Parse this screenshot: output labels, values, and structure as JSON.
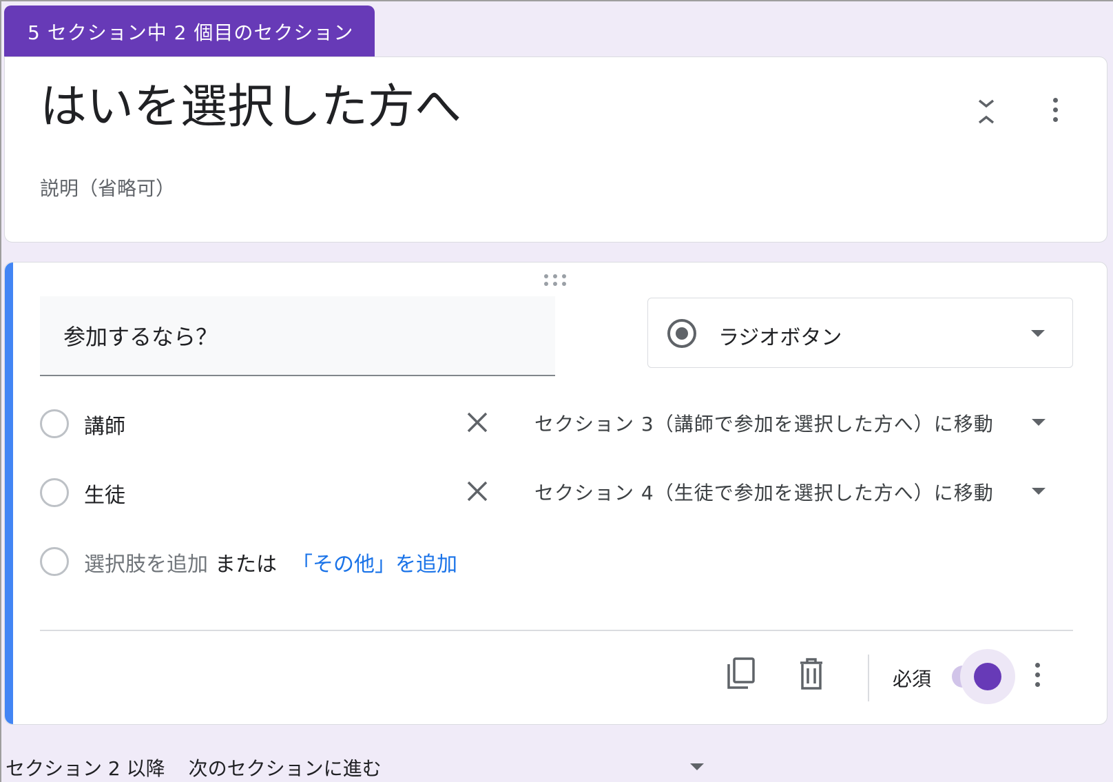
{
  "section_tab": "5 セクション中 2 個目のセクション",
  "section": {
    "title": "はいを選択した方へ",
    "description_placeholder": "説明（省略可）"
  },
  "question": {
    "title": "参加するなら？",
    "type_label": "ラジオボタン",
    "options": [
      {
        "label": "講師",
        "goto": "セクション 3（講師で参加を選択した方へ）に移動"
      },
      {
        "label": "生徒",
        "goto": "セクション 4（生徒で参加を選択した方へ）に移動"
      }
    ],
    "add_option": "選択肢を追加",
    "or_text": "または",
    "add_other": "「その他」を追加",
    "required_label": "必須",
    "required": true
  },
  "after_section": {
    "label": "セクション 2 以降",
    "value": "次のセクションに進む"
  },
  "colors": {
    "accent": "#673ab7",
    "focus_bar": "#4285f4",
    "link": "#1a73e8",
    "background": "#f0ebf8"
  },
  "icons": [
    "collapse-icon",
    "more-vert-icon",
    "drag-handle-icon",
    "radio-icon",
    "close-icon",
    "copy-icon",
    "delete-icon",
    "dropdown-arrow-icon"
  ]
}
